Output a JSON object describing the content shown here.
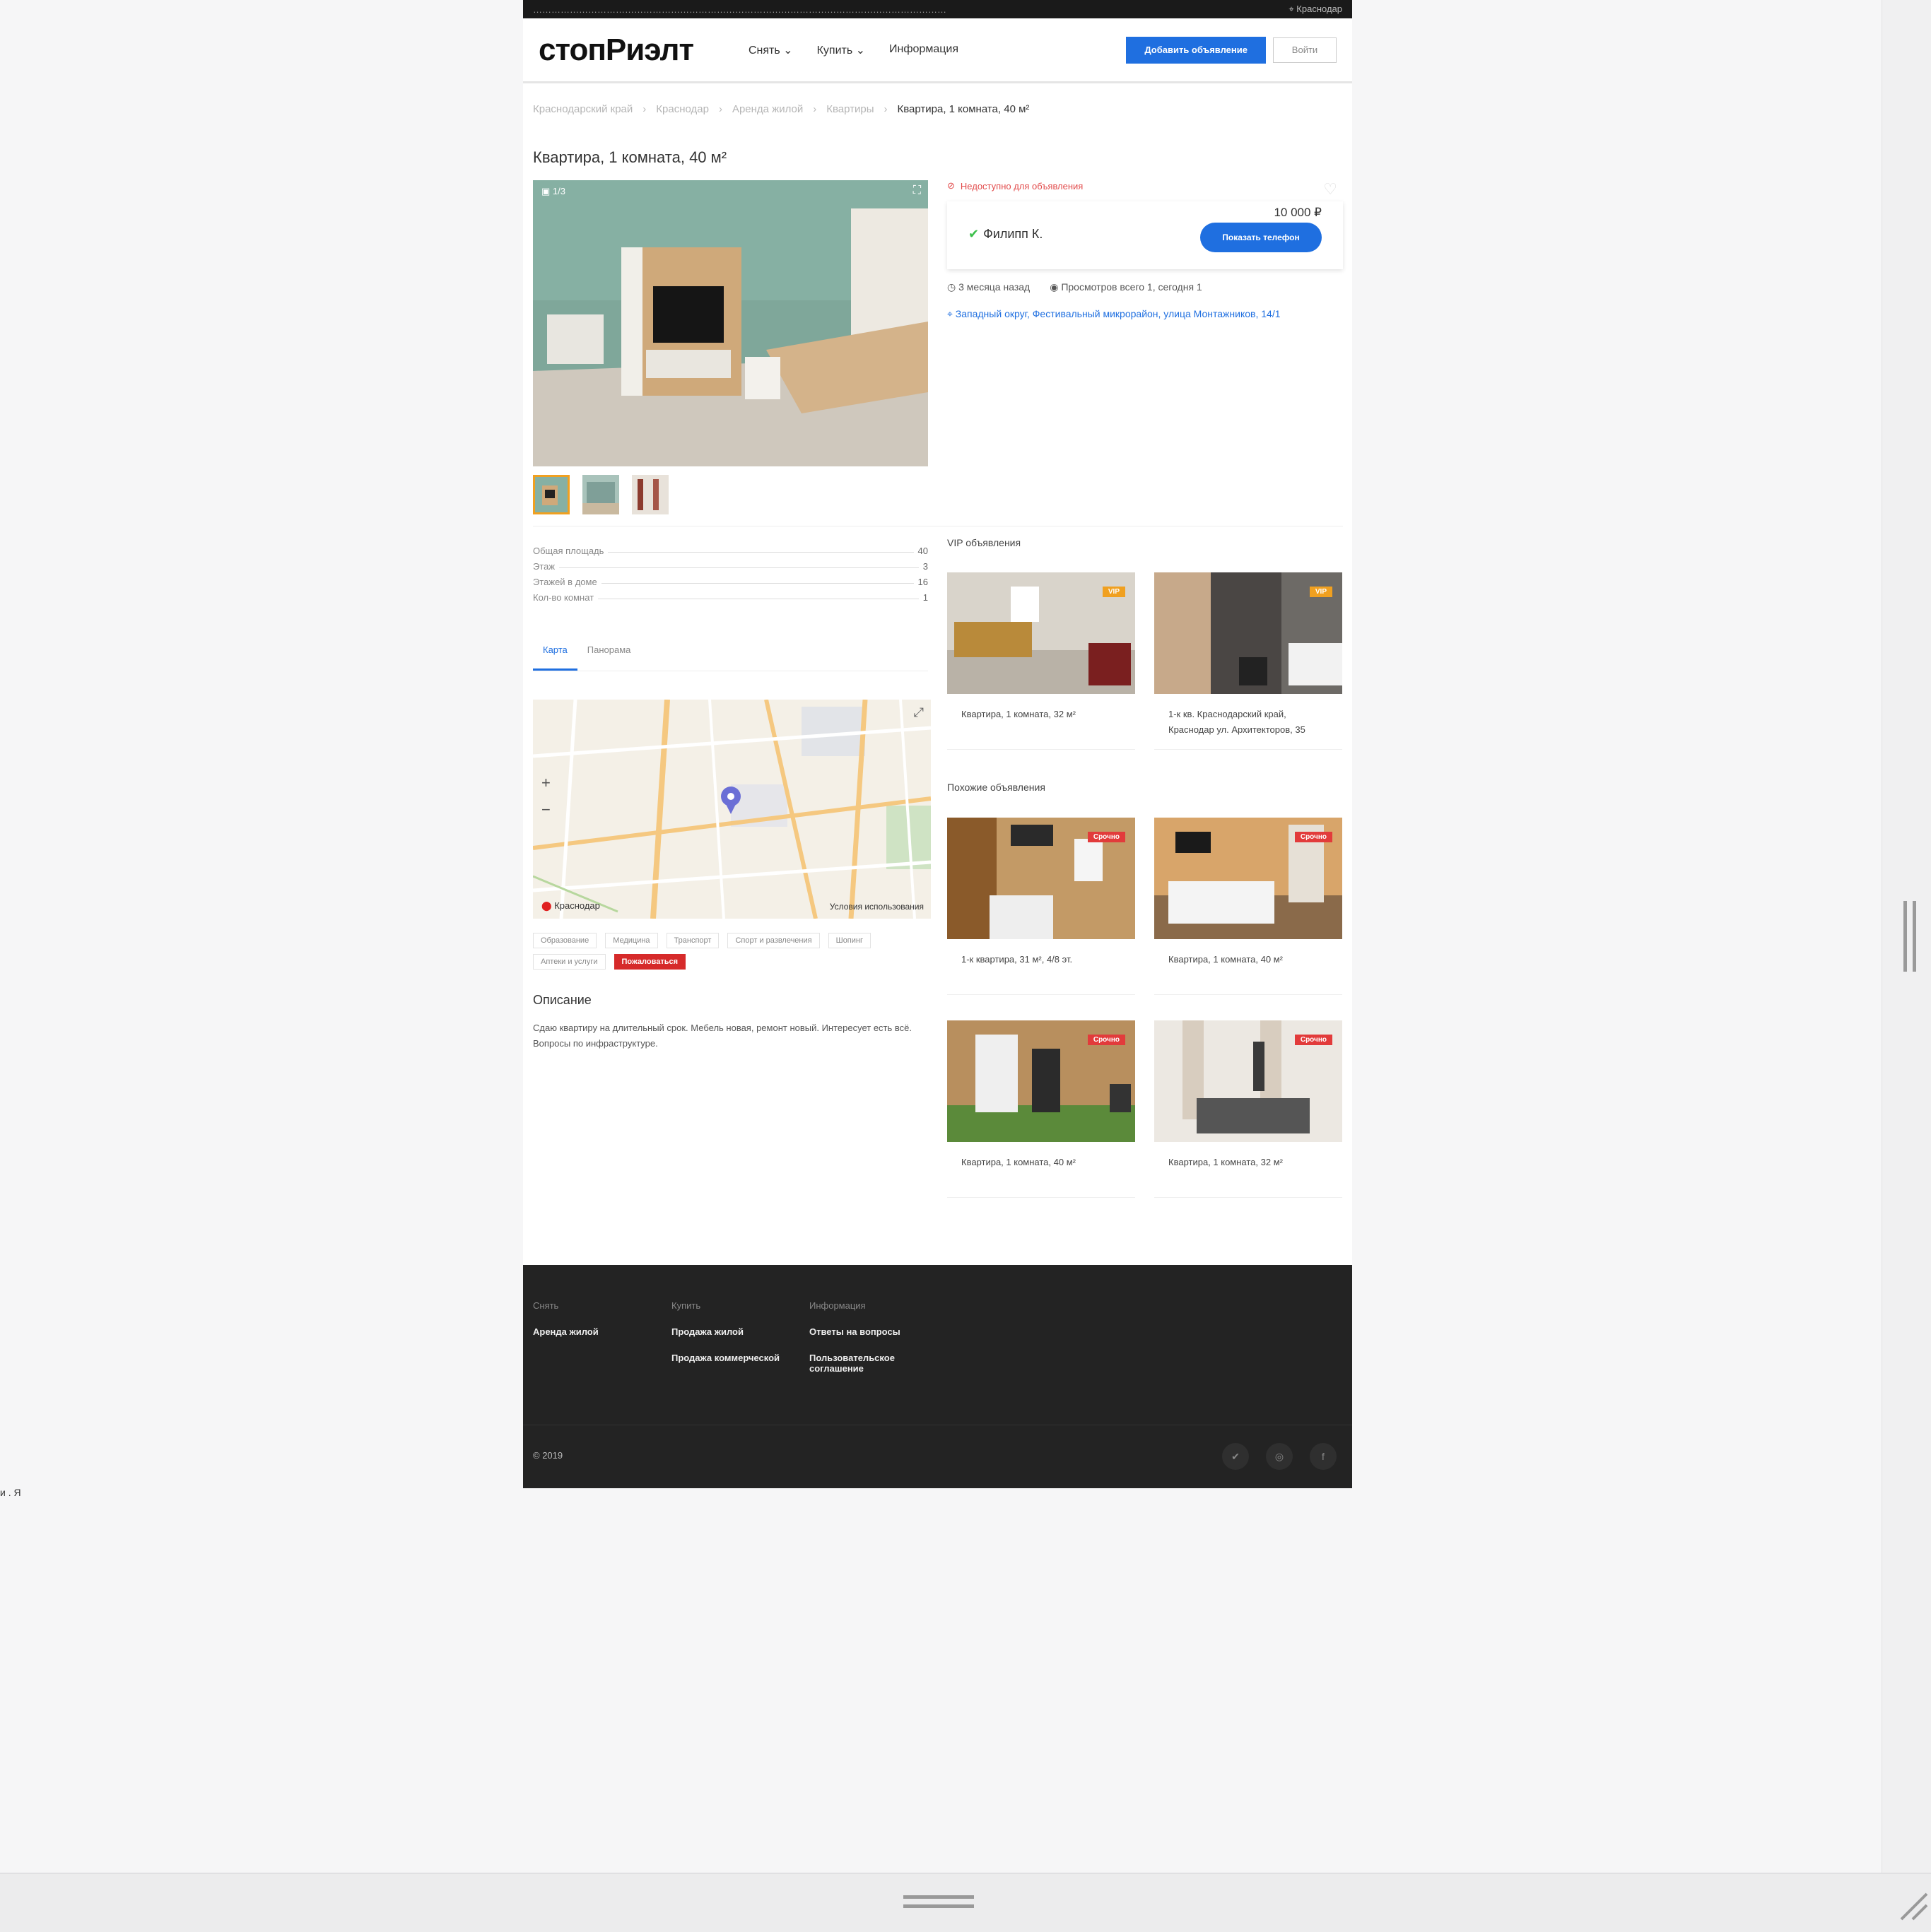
{
  "topbar": {
    "message": "………………………………………………………………………………………………………………………",
    "city": "Краснодар"
  },
  "header": {
    "logo": "стопРиэлт",
    "nav": [
      {
        "label": "Снять",
        "dropdown": true
      },
      {
        "label": "Купить",
        "dropdown": true
      },
      {
        "label": "Информация",
        "dropdown": false
      }
    ],
    "add_button": "Добавить объявление",
    "login_button": "Войти"
  },
  "breadcrumbs": [
    "Краснодарский край",
    "Краснодар",
    "Аренда жилой",
    "Квартиры",
    "Квартира, 1 комната, 40 м²"
  ],
  "listing": {
    "title": "Квартира, 1 комната, 40 м²",
    "photo_counter": "1/3",
    "notice": "Недоступно для объявления",
    "price": "10 000 ₽",
    "seller_name": "Филипп К.",
    "call_button": "Показать телефон",
    "meta": [
      "3 месяца назад",
      "Просмотров всего 1, сегодня 1"
    ],
    "address": "Западный округ, Фестивальный микрорайон, улица Монтажников, 14/1",
    "params": [
      {
        "label": "Общая площадь",
        "value": "40"
      },
      {
        "label": "Этаж",
        "value": "3"
      },
      {
        "label": "Этажей в доме",
        "value": "16"
      },
      {
        "label": "Кол-во комнат",
        "value": "1"
      }
    ],
    "tabs": [
      "Карта",
      "Панорама"
    ],
    "map": {
      "city": "Краснодар",
      "terms": "Условия использования"
    },
    "chips": [
      "Образование",
      "Медицина",
      "Транспорт",
      "Спорт и развлечения",
      "Шопинг",
      "Аптеки и услуги"
    ],
    "report_chip": "Пожаловаться",
    "description_heading": "Описание",
    "description": "Сдаю квартиру на длительный срок. Мебель новая, ремонт новый. Интересует есть всё. Вопросы по инфраструктуре."
  },
  "vip": {
    "heading": "VIP объявления",
    "items": [
      {
        "caption": "Квартира, 1 комната, 32 м²",
        "badge": "VIP"
      },
      {
        "caption": "1-к кв. Краснодарский край, Краснодар ул. Архитекторов, 35",
        "badge": "VIP"
      }
    ]
  },
  "similar": {
    "heading": "Похожие объявления",
    "items": [
      {
        "caption": "1-к квартира, 31 м², 4/8 эт.",
        "badge": "Срочно"
      },
      {
        "caption": "Квартира, 1 комната, 40 м²",
        "badge": "Срочно"
      },
      {
        "caption": "Квартира, 1 комната, 40 м²",
        "badge": "Срочно"
      },
      {
        "caption": "Квартира, 1 комната, 32 м²",
        "badge": "Срочно"
      }
    ]
  },
  "footer": {
    "columns": [
      {
        "heading": "Снять",
        "links": [
          "Аренда жилой"
        ]
      },
      {
        "heading": "Купить",
        "links": [
          "Продажа жилой",
          "Продажа коммерческой"
        ]
      },
      {
        "heading": "Информация",
        "links": [
          "Ответы на вопросы",
          "Пользовательское соглашение"
        ]
      }
    ],
    "copyright": "© 2019",
    "social": [
      "vk-icon",
      "ok-icon",
      "facebook-icon"
    ]
  },
  "stray_text": "и  . Я",
  "colors": {
    "accent": "#1f6fe0",
    "urgent": "#e23b3b",
    "vip": "#f0a020",
    "footer": "#232323"
  }
}
